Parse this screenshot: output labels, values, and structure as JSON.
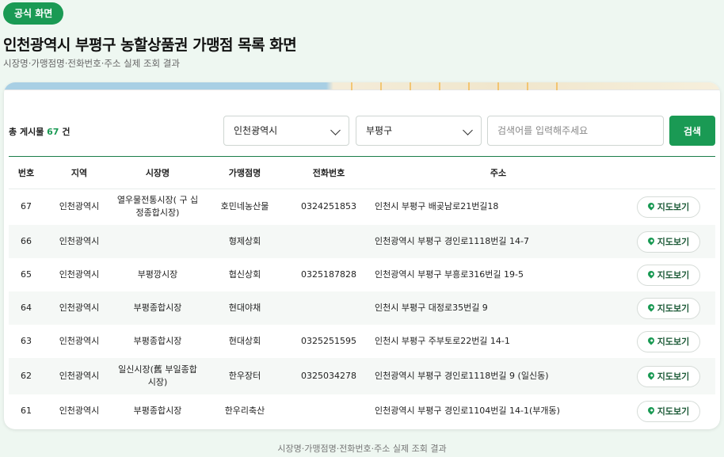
{
  "badge": "공식 화면",
  "title": "인천광역시 부평구 농할상품권 가맹점 목록 화면",
  "subtitle": "시장명·가맹점명·전화번호·주소 실제 조회 결과",
  "toolbar": {
    "total_prefix": "총 게시물",
    "total_count": "67",
    "total_suffix": "건",
    "city_select": "인천광역시",
    "district_select": "부평구",
    "search_placeholder": "검색어를 입력해주세요",
    "search_button": "검색"
  },
  "table": {
    "headers": [
      "번호",
      "지역",
      "시장명",
      "가맹점명",
      "전화번호",
      "주소",
      ""
    ],
    "map_button_label": "지도보기",
    "rows": [
      {
        "no": "67",
        "region": "인천광역시",
        "market": "열우물전통시장( 구 십정종합시장)",
        "store": "호민네농산물",
        "phone": "0324251853",
        "address": "인천시 부평구 배곶남로21번길18"
      },
      {
        "no": "66",
        "region": "인천광역시",
        "market": "",
        "store": "형제상회",
        "phone": "",
        "address": "인천광역시 부평구 경인로1118번길 14-7"
      },
      {
        "no": "65",
        "region": "인천광역시",
        "market": "부평깡시장",
        "store": "협신상회",
        "phone": "0325187828",
        "address": "인천광역시 부평구 부흥로316번길 19-5"
      },
      {
        "no": "64",
        "region": "인천광역시",
        "market": "부평종합시장",
        "store": "현대야채",
        "phone": "",
        "address": "인천시 부평구 대정로35번길 9"
      },
      {
        "no": "63",
        "region": "인천광역시",
        "market": "부평종합시장",
        "store": "현대상회",
        "phone": "0325251595",
        "address": "인천시 부평구 주부토로22번길 14-1"
      },
      {
        "no": "62",
        "region": "인천광역시",
        "market": "일신시장(舊 부일종합시장)",
        "store": "한우장터",
        "phone": "0325034278",
        "address": "인천광역시 부평구 경인로1118번길 9 (일신동)"
      },
      {
        "no": "61",
        "region": "인천광역시",
        "market": "부평종합시장",
        "store": "한우리축산",
        "phone": "",
        "address": "인천광역시 부평구 경인로1104번길 14-1(부개동)"
      }
    ]
  },
  "footer_caption": "시장명·가맹점명·전화번호·주소 실제 조회 결과",
  "colors": {
    "accent": "#1a9a54",
    "background": "#eef7f1"
  }
}
